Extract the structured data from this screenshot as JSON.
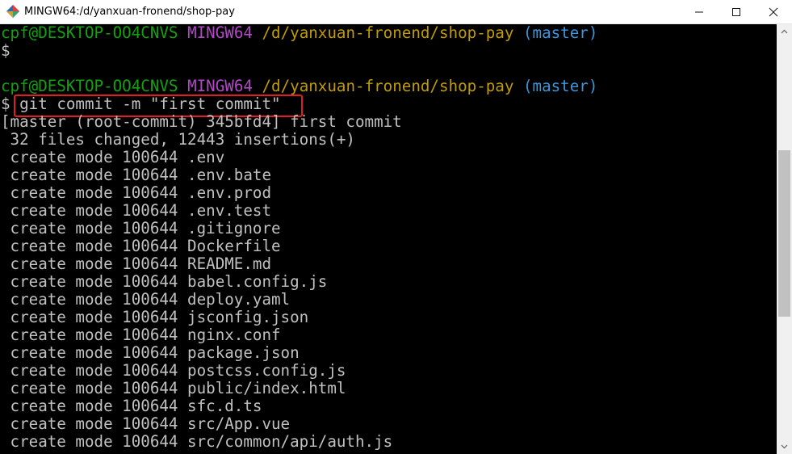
{
  "window": {
    "title": "MINGW64:/d/yanxuan-fronend/shop-pay",
    "app_icon": "mingw-diamond-icon",
    "controls": [
      "minimize-icon",
      "maximize-icon",
      "close-icon"
    ]
  },
  "colors": {
    "user": "#13a10e",
    "system": "#b148c6",
    "path": "#c19c00",
    "branch": "#3a96dd",
    "text": "#c0c0c0",
    "highlight": "#e02020"
  },
  "terminal": {
    "prompt1": {
      "user_host": "cpf@DESKTOP-OO4CNVS",
      "system": "MINGW64",
      "path": "/d/yanxuan-fronend/shop-pay",
      "branch": "(master)",
      "symbol": "$"
    },
    "prompt2": {
      "user_host": "cpf@DESKTOP-OO4CNVS",
      "system": "MINGW64",
      "path": "/d/yanxuan-fronend/shop-pay",
      "branch": "(master)",
      "symbol": "$",
      "command": "git commit -m \"first commit\""
    },
    "output": [
      "[master (root-commit) 345bfd4] first commit",
      " 32 files changed, 12443 insertions(+)",
      " create mode 100644 .env",
      " create mode 100644 .env.bate",
      " create mode 100644 .env.prod",
      " create mode 100644 .env.test",
      " create mode 100644 .gitignore",
      " create mode 100644 Dockerfile",
      " create mode 100644 README.md",
      " create mode 100644 babel.config.js",
      " create mode 100644 deploy.yaml",
      " create mode 100644 jsconfig.json",
      " create mode 100644 nginx.conf",
      " create mode 100644 package.json",
      " create mode 100644 postcss.config.js",
      " create mode 100644 public/index.html",
      " create mode 100644 sfc.d.ts",
      " create mode 100644 src/App.vue",
      " create mode 100644 src/common/api/auth.js"
    ]
  }
}
